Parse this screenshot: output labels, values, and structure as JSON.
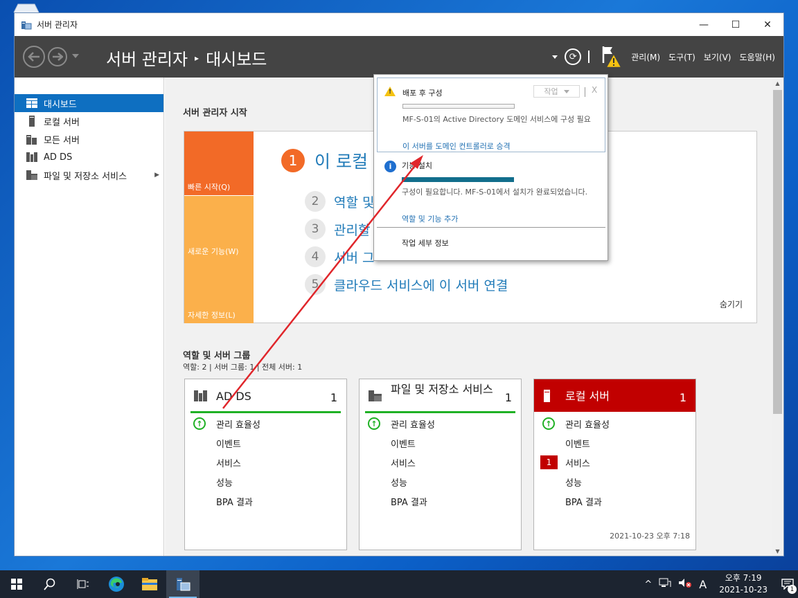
{
  "window": {
    "title": "서버 관리자",
    "controls": {
      "minimize": "—",
      "maximize": "☐",
      "close": "✕"
    }
  },
  "header": {
    "breadcrumb_root": "서버 관리자",
    "breadcrumb_sep": "▸",
    "breadcrumb_page": "대시보드",
    "menus": [
      "관리(M)",
      "도구(T)",
      "보기(V)",
      "도움말(H)"
    ],
    "refresh_glyph": "⟳"
  },
  "sidebar": {
    "items": [
      {
        "label": "대시보드",
        "icon": "dashboard-icon",
        "active": true
      },
      {
        "label": "로컬 서버",
        "icon": "server-icon"
      },
      {
        "label": "모든 서버",
        "icon": "servers-icon"
      },
      {
        "label": "AD DS",
        "icon": "adds-icon"
      },
      {
        "label": "파일 및 저장소 서비스",
        "icon": "file-storage-icon",
        "expand": "▶"
      }
    ]
  },
  "welcome": {
    "section_title": "서버 관리자 시작",
    "tiles": [
      "빠른 시작(Q)",
      "새로운 기능(W)",
      "자세한 정보(L)"
    ],
    "step1": {
      "num": "1",
      "text": "이 로컬"
    },
    "steps": [
      {
        "num": "2",
        "text": "역할 및"
      },
      {
        "num": "3",
        "text": "관리할"
      },
      {
        "num": "4",
        "text": "서버 그"
      },
      {
        "num": "5",
        "text": "클라우드 서비스에 이 서버 연결"
      }
    ],
    "hide": "숨기기"
  },
  "roles": {
    "section_title": "역할 및 서버 그룹",
    "summary": "역할: 2   |   서버 그룹: 1   |   전체 서버: 1",
    "cards": [
      {
        "name": "AD DS",
        "count": "1",
        "rows": [
          "관리 효율성",
          "이벤트",
          "서비스",
          "성능",
          "BPA 결과"
        ]
      },
      {
        "name": "파일 및 저장소 서비스",
        "count": "1",
        "rows": [
          "관리 효율성",
          "이벤트",
          "서비스",
          "성능",
          "BPA 결과"
        ]
      },
      {
        "name": "로컬 서버",
        "count": "1",
        "rows": [
          "관리 효율성",
          "이벤트",
          "서비스",
          "성능",
          "BPA 결과"
        ],
        "service_badge": "1",
        "timestamp": "2021-10-23 오후 7:18"
      }
    ]
  },
  "flyout": {
    "n1": {
      "title": "배포 후 구성",
      "task_button": "작업",
      "close": "X",
      "desc": "MF-S-01의 Active Directory 도메인 서비스에 구성 필요",
      "link": "이 서버를 도메인 컨트롤러로 승격"
    },
    "n2": {
      "title": "기능 설치",
      "desc": "구성이 필요합니다. MF-S-01에서 설치가 완료되었습니다.",
      "link": "역할 및 기능 추가"
    },
    "details": "작업 세부 정보"
  },
  "taskbar": {
    "tray_chevron": "^",
    "ime": "A",
    "time": "오후 7:19",
    "date": "2021-10-23",
    "notification_count": "1"
  },
  "colors": {
    "header_bg": "#444444",
    "accent_blue": "#0e6fc1",
    "quick_start": "#f26a27",
    "tile_orange": "#fbb04b",
    "status_green": "#1fb124",
    "alert_red": "#c10000",
    "annotation_arrow": "#e0262b"
  }
}
